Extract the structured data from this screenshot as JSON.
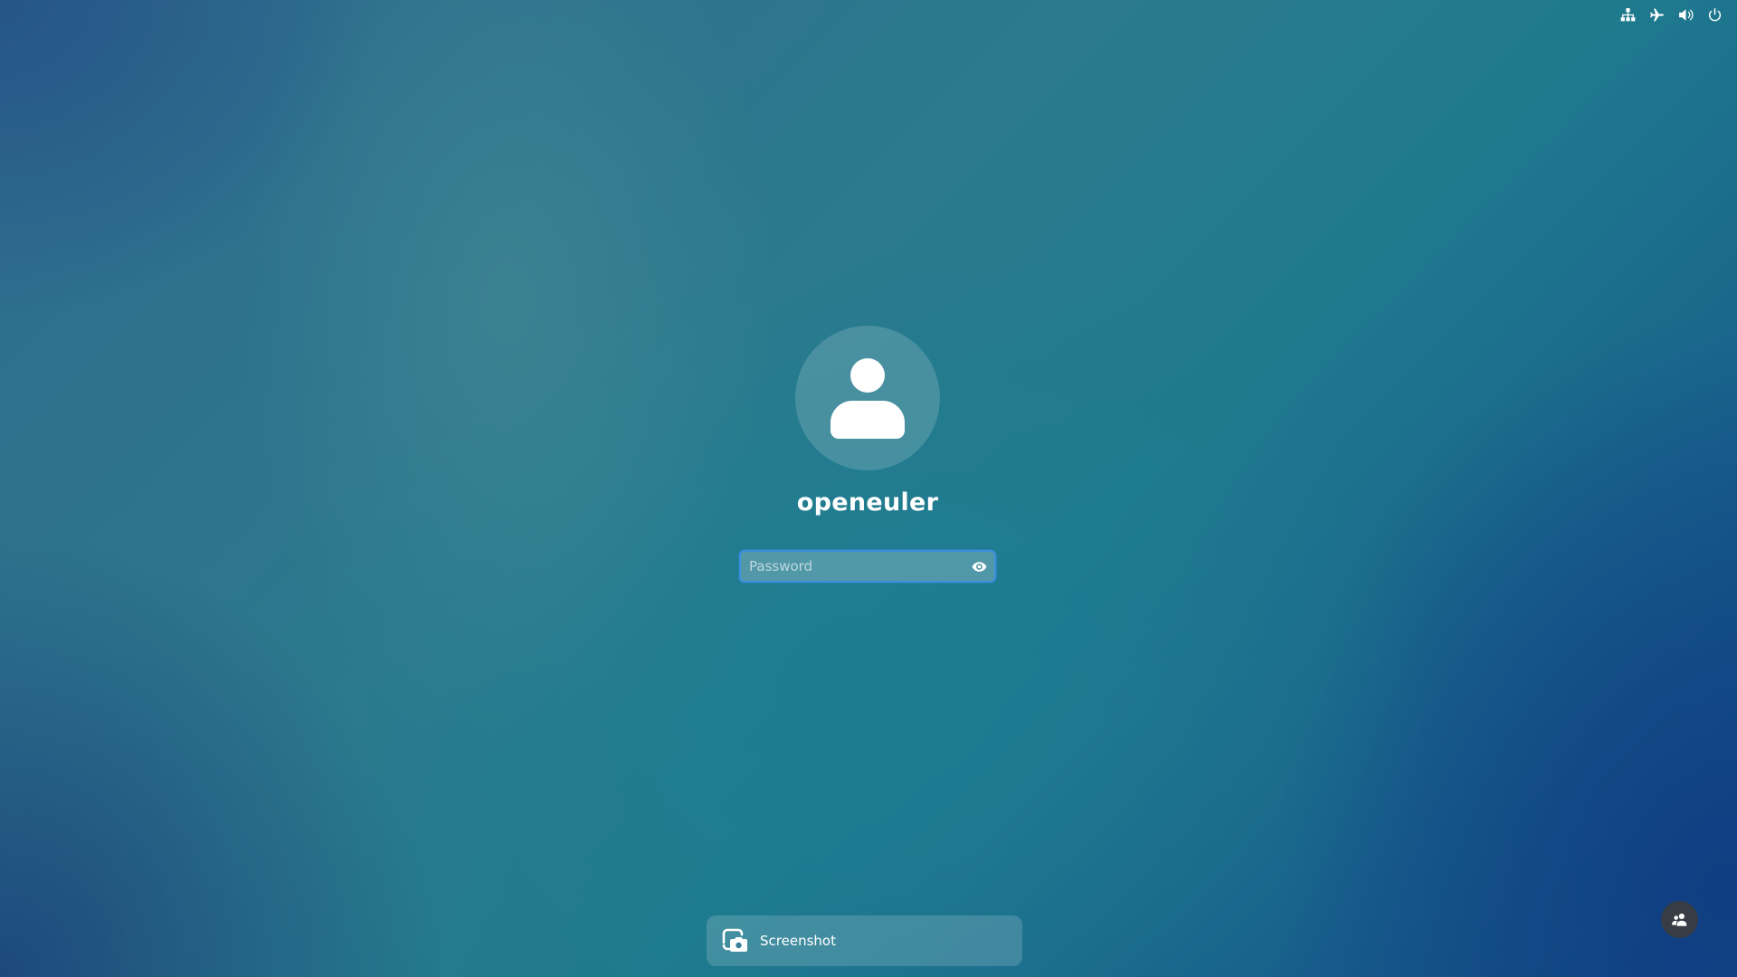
{
  "top_bar": {
    "icons": [
      "network-wired-icon",
      "airplane-mode-icon",
      "volume-icon",
      "power-icon"
    ]
  },
  "login": {
    "avatar_icon": "user-avatar-icon",
    "username": "openeuler",
    "password": {
      "value": "",
      "placeholder": "Password",
      "reveal_icon": "eye-icon"
    }
  },
  "notification": {
    "icon": "screenshot-icon",
    "label": "Screenshot"
  },
  "switch_user": {
    "icon": "switch-user-icon"
  },
  "colors": {
    "focus_ring": "#3d8fe0",
    "text": "#ffffff"
  }
}
